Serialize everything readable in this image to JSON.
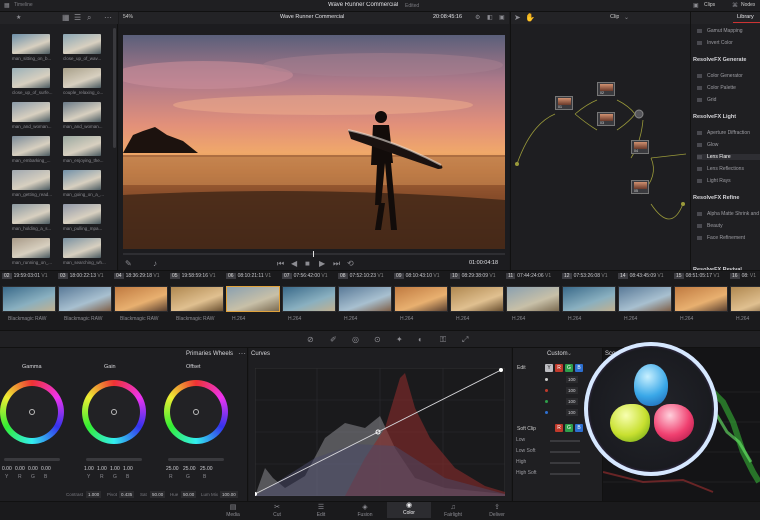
{
  "app": {
    "project_title": "Wave Runner Commercial",
    "edited_label": "Edited",
    "timeline_label": "Timeline",
    "clips_label": "Clips",
    "nodes_label": "Nodes",
    "library_tab": "Library",
    "zoom": "54%",
    "source_timecode": "20:08:45:16",
    "clip_mode": "Clip",
    "record_timecode": "01:00:04:18"
  },
  "media_pool": [
    {
      "label": "man_sitting_on_b..."
    },
    {
      "label": "close_up_of_wav..."
    },
    {
      "label": "close_up_of_surfe..."
    },
    {
      "label": "couple_relaxing_o..."
    },
    {
      "label": "man_and_woman..."
    },
    {
      "label": "man_and_woman..."
    },
    {
      "label": "man_embarking_..."
    },
    {
      "label": "man_enjoying_the..."
    },
    {
      "label": "man_getting_read..."
    },
    {
      "label": "man_going_on_a_..."
    },
    {
      "label": "man_holding_a_s..."
    },
    {
      "label": "man_pulling_mpa..."
    },
    {
      "label": "man_running_on_..."
    },
    {
      "label": "man_searching_wh..."
    }
  ],
  "timeline": {
    "clips": [
      {
        "num": "02",
        "tc": "19:59:03:01",
        "track": "V1",
        "format": "Blackmagic RAW"
      },
      {
        "num": "03",
        "tc": "18:00:22:13",
        "track": "V1",
        "format": "Blackmagic RAW"
      },
      {
        "num": "04",
        "tc": "18:36:29:18",
        "track": "V1",
        "format": "Blackmagic RAW"
      },
      {
        "num": "05",
        "tc": "19:58:59:16",
        "track": "V1",
        "format": "Blackmagic RAW"
      },
      {
        "num": "06",
        "tc": "08:10:21:11",
        "track": "V1",
        "format": "H.264"
      },
      {
        "num": "07",
        "tc": "07:56:42:00",
        "track": "V1",
        "format": "H.264"
      },
      {
        "num": "08",
        "tc": "07:52:10:23",
        "track": "V1",
        "format": "H.264"
      },
      {
        "num": "09",
        "tc": "08:10:43:10",
        "track": "V1",
        "format": "H.264"
      },
      {
        "num": "10",
        "tc": "08:29:38:09",
        "track": "V1",
        "format": "H.264"
      },
      {
        "num": "11",
        "tc": "07:44:24:06",
        "track": "V1",
        "format": "H.264"
      },
      {
        "num": "12",
        "tc": "07:53:26:08",
        "track": "V1",
        "format": "H.264"
      },
      {
        "num": "14",
        "tc": "08:43:45:09",
        "track": "V1",
        "format": "H.264"
      },
      {
        "num": "15",
        "tc": "08:51:05:17",
        "track": "V1",
        "format": "H.264"
      },
      {
        "num": "16",
        "tc": "08:",
        "track": "V1",
        "format": "H.264"
      }
    ]
  },
  "primaries": {
    "title": "Primaries Wheels",
    "wheels": [
      {
        "name": "Gamma",
        "values": [
          "0.00",
          "0.00",
          "0.00",
          "0.00"
        ],
        "keys": [
          "Y",
          "R",
          "G",
          "B"
        ]
      },
      {
        "name": "Gain",
        "values": [
          "1.00",
          "1.00",
          "1.00",
          "1.00"
        ],
        "keys": [
          "Y",
          "R",
          "G",
          "B"
        ]
      },
      {
        "name": "Offset",
        "values": [
          "25.00",
          "25.00",
          "25.00"
        ],
        "keys": [
          "R",
          "G",
          "B"
        ]
      }
    ],
    "footer": {
      "contrast_label": "Contrast",
      "contrast": "1.000",
      "pivot_label": "Pivot",
      "pivot": "0.435",
      "sat_label": "Sat",
      "sat": "50.00",
      "hue_label": "Hue",
      "hue": "50.00",
      "lum_label": "Lum Mix",
      "lum": "100.00"
    }
  },
  "curves": {
    "title": "Curves",
    "mode": "Custom",
    "edit_label": "Edit",
    "edit_values": [
      "100",
      "100",
      "100",
      "100"
    ],
    "soft_clip_label": "Soft Clip",
    "soft_clip_rows": [
      "Low",
      "Low Soft",
      "High",
      "High Soft"
    ]
  },
  "scopes": {
    "title": "Scop"
  },
  "nodes": [
    {
      "label": "01"
    },
    {
      "label": "02"
    },
    {
      "label": "03"
    },
    {
      "label": "04"
    },
    {
      "label": "05"
    }
  ],
  "library": {
    "sections": [
      {
        "items": [
          "Gamut Mapping",
          "Invert Color"
        ]
      },
      {
        "title": "ResolveFX Generate",
        "items": [
          "Color Generator",
          "Color Palette",
          "Grid"
        ]
      },
      {
        "title": "ResolveFX Light",
        "items": [
          "Aperture Diffraction",
          "Glow",
          "Lens Flare",
          "Lens Reflections",
          "Light Rays"
        ]
      },
      {
        "title": "ResolveFX Refine",
        "items": [
          "Alpha Matte Shrink and Grow",
          "Beauty",
          "Face Refinement"
        ]
      }
    ],
    "cut_off_heading": "ResolveFX Revival"
  },
  "pages": [
    "Media",
    "Cut",
    "Edit",
    "Fusion",
    "Color",
    "Fairlight",
    "Deliver"
  ],
  "active_page": "Color",
  "colors": {
    "accent": "#e0a23c",
    "red_chip": "#c0392b",
    "green_chip": "#2e9e4a",
    "blue_chip": "#2d6fd0"
  }
}
